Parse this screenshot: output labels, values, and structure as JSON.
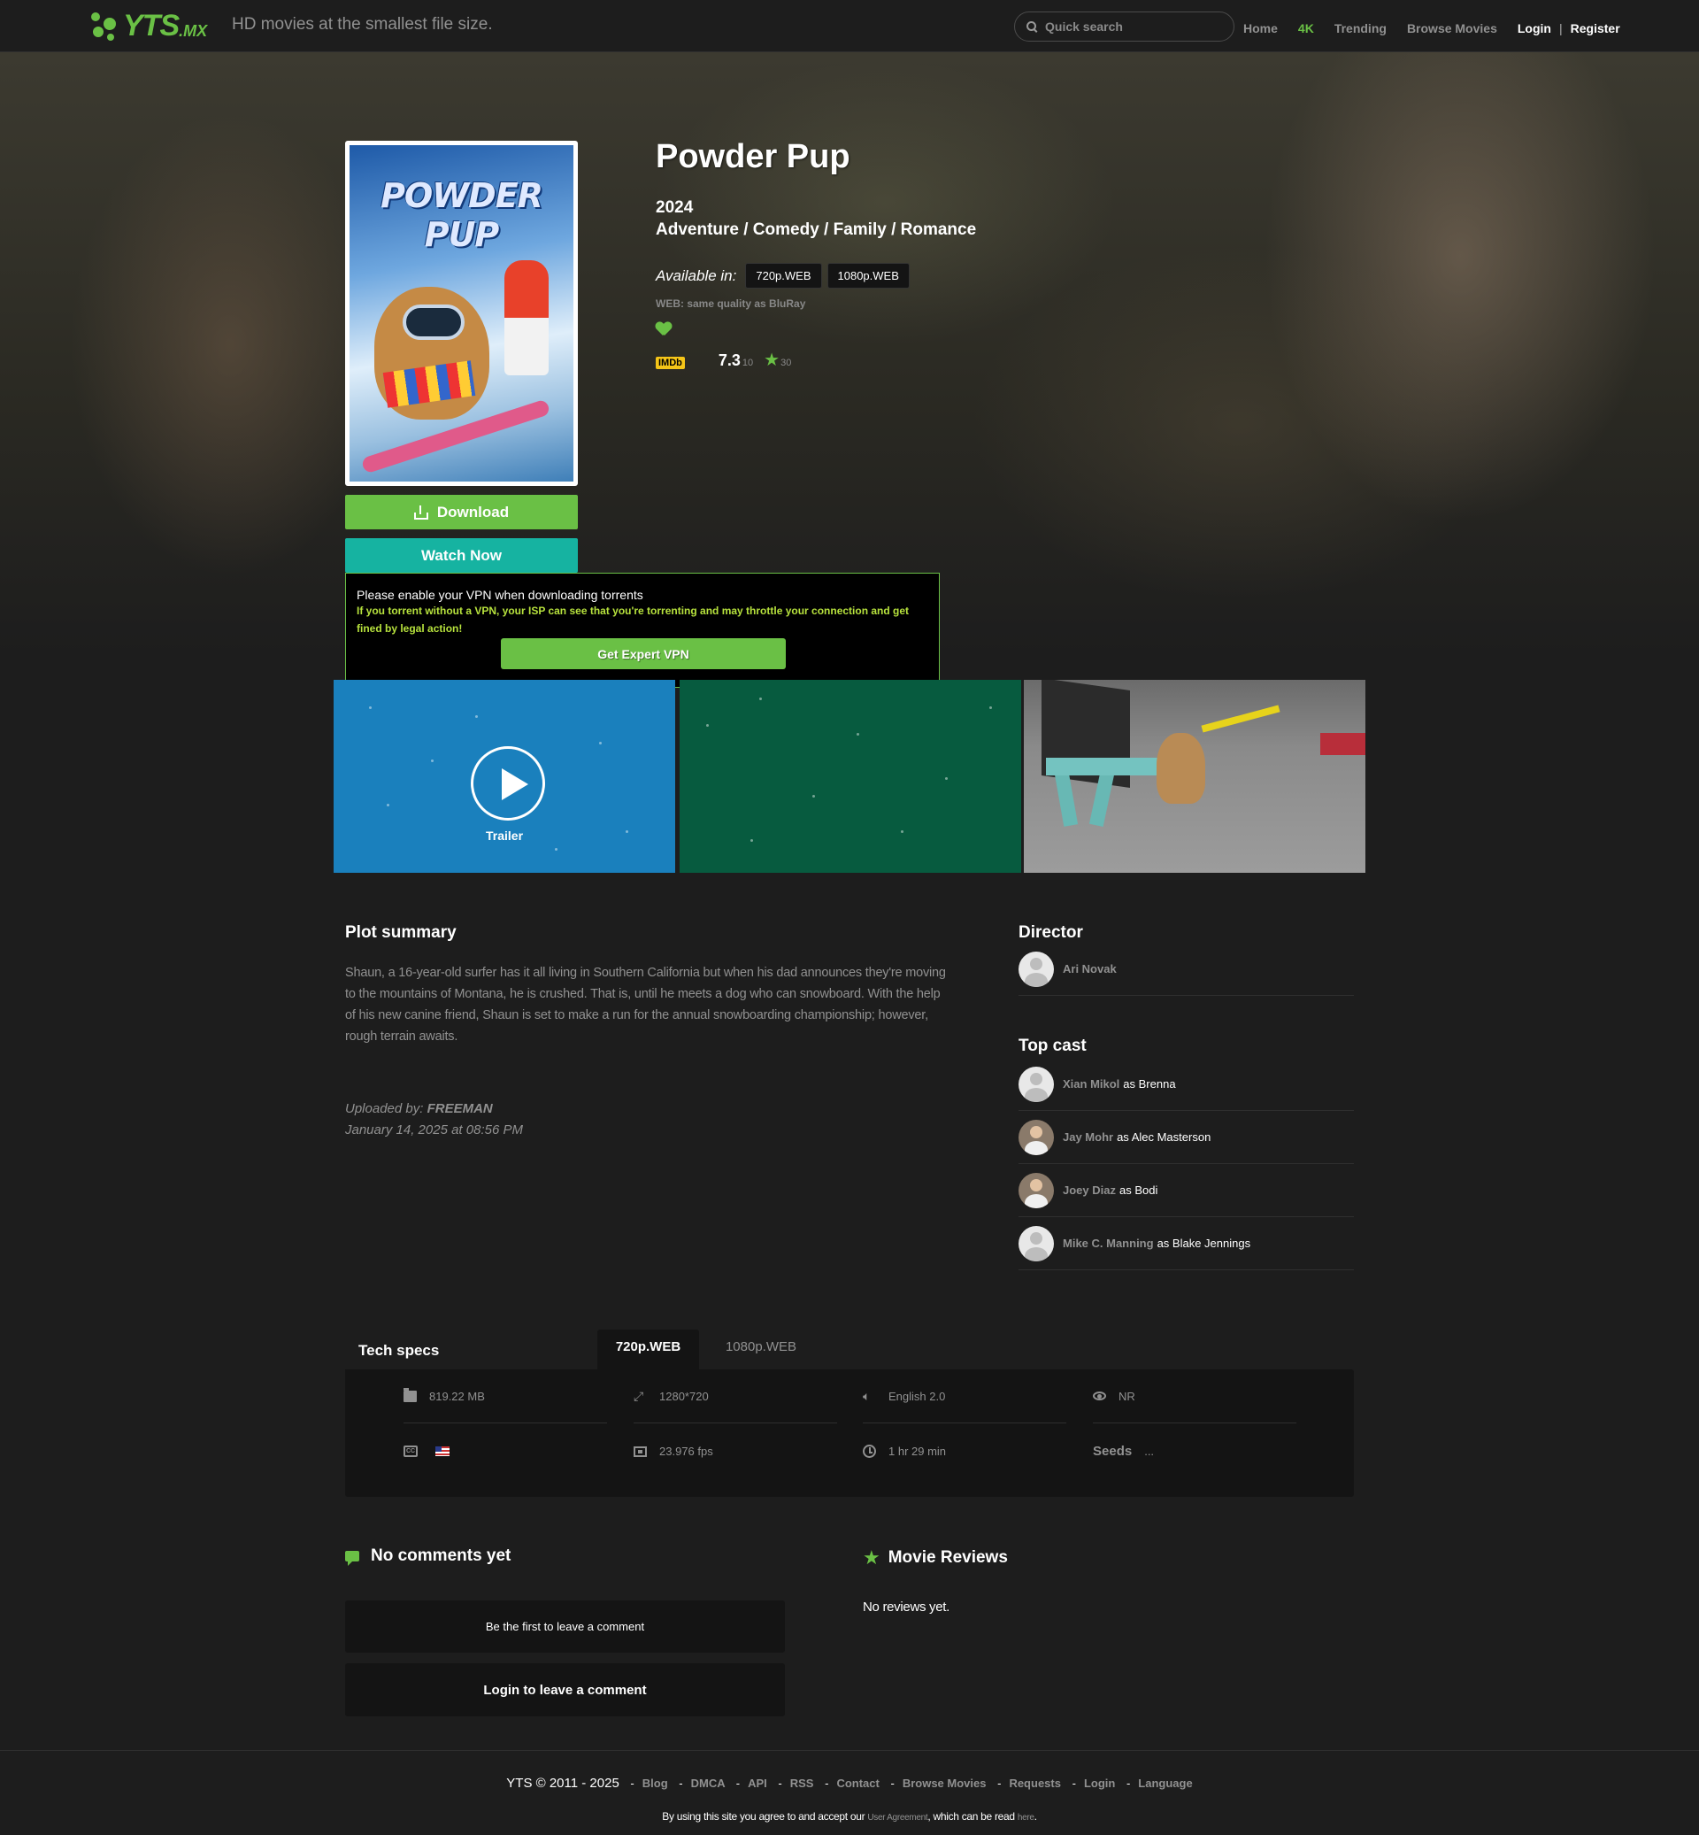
{
  "header": {
    "logo_text": "YTS",
    "logo_tld": ".MX",
    "tagline": "HD movies at the smallest file size.",
    "search_placeholder": "Quick search",
    "nav": {
      "home": "Home",
      "k4": "4K",
      "trending": "Trending",
      "browse": "Browse Movies",
      "login": "Login",
      "separator": "|",
      "register": "Register"
    },
    "accent_color": "#6ac045"
  },
  "movie": {
    "poster_title": "POWDER PUP",
    "title": "Powder Pup",
    "year": "2024",
    "genres": "Adventure / Comedy / Family / Romance",
    "available_label": "Available in:",
    "qualities": [
      "720p.WEB",
      "1080p.WEB"
    ],
    "web_note": "WEB: same quality as BluRay",
    "imdb_label": "IMDb",
    "rating": "7.3",
    "rating_max": "10",
    "votes": "30"
  },
  "actions": {
    "download": "Download",
    "watch_now": "Watch Now",
    "download_color": "#6ac045",
    "watch_color": "#16b3a1"
  },
  "vpn": {
    "title": "Please enable your VPN when downloading torrents",
    "warning": "If you torrent without a VPN, your ISP can see that you're torrenting and may throttle your connection and get fined by legal action!",
    "button": "Get Expert VPN"
  },
  "screenshots": {
    "trailer_label": "Trailer"
  },
  "plot": {
    "heading": "Plot summary",
    "text": "Shaun, a 16-year-old surfer has it all living in Southern California but when his dad announces they're moving to the mountains of Montana, he is crushed. That is, until he meets a dog who can snowboard. With the help of his new canine friend, Shaun is set to make a run for the annual snowboarding championship; however, rough terrain awaits.",
    "uploaded_label": "Uploaded by:",
    "uploader": "FREEMAN",
    "uploaded_date": "January 14, 2025 at 08:56 PM"
  },
  "director": {
    "heading": "Director",
    "name": "Ari Novak"
  },
  "cast": {
    "heading": "Top cast",
    "members": [
      {
        "name": "Xian Mikol",
        "role": "as Brenna"
      },
      {
        "name": "Jay Mohr",
        "role": "as Alec Masterson"
      },
      {
        "name": "Joey Diaz",
        "role": "as Bodi"
      },
      {
        "name": "Mike C. Manning",
        "role": "as Blake Jennings"
      }
    ]
  },
  "tech_specs": {
    "heading": "Tech specs",
    "tabs": [
      "720p.WEB",
      "1080p.WEB"
    ],
    "size": "819.22 MB",
    "resolution": "1280*720",
    "audio": "English 2.0",
    "rating": "NR",
    "subtitles_icon": "CC",
    "fps": "23.976 fps",
    "runtime": "1 hr 29 min",
    "seeds_label": "Seeds",
    "seeds_value": "..."
  },
  "comments": {
    "heading": "No comments yet",
    "first_prompt": "Be the first to leave a comment",
    "login_prompt": "Login to leave a comment"
  },
  "reviews": {
    "heading": "Movie Reviews",
    "empty": "No reviews yet."
  },
  "footer": {
    "copyright": "YTS © 2011 - 2025",
    "links": [
      "Blog",
      "DMCA",
      "API",
      "RSS",
      "Contact",
      "Browse Movies",
      "Requests",
      "Login",
      "Language"
    ],
    "note_prefix": "By using this site you agree to and accept our",
    "agreement_link": "User Agreement",
    "note_middle": ", which can be read",
    "here_link": "here",
    "note_suffix": "."
  }
}
